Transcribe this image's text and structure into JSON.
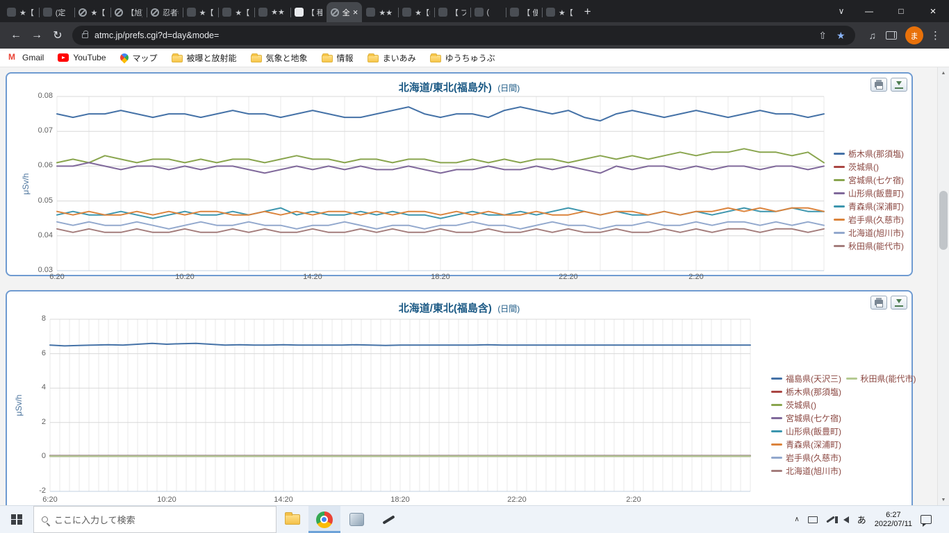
{
  "browser": {
    "tabs": [
      {
        "label": "★【",
        "favicon": "dark"
      },
      {
        "label": "(定",
        "favicon": "dark"
      },
      {
        "label": "★【",
        "favicon": "circle"
      },
      {
        "label": "【旭]",
        "favicon": "circle"
      },
      {
        "label": "忍者=",
        "favicon": "circle"
      },
      {
        "label": "★【",
        "favicon": "dark"
      },
      {
        "label": "★【",
        "favicon": "dark"
      },
      {
        "label": "★★",
        "favicon": "dark"
      },
      {
        "label": "【 種",
        "favicon": "light"
      },
      {
        "label": "全",
        "favicon": "circle",
        "active": true
      },
      {
        "label": "★★【",
        "favicon": "dark"
      },
      {
        "label": "★【≡",
        "favicon": "dark"
      },
      {
        "label": "【 フ",
        "favicon": "dark"
      },
      {
        "label": "(",
        "favicon": "dark"
      },
      {
        "label": "【 便",
        "favicon": "dark"
      },
      {
        "label": "★【",
        "favicon": "dark"
      }
    ],
    "tab_close_glyph": "×",
    "new_tab_glyph": "+",
    "tab_search_glyph": "∨",
    "window_controls": {
      "minimize": "—",
      "maximize": "□",
      "close": "×"
    },
    "nav": {
      "back": "←",
      "forward": "→",
      "reload": "↻",
      "url": "atmc.jp/prefs.cgi?d=day&mode=",
      "share": "⇧",
      "star": "★",
      "media": "♫",
      "menu": "⋮",
      "profile_initial": "ま"
    },
    "bookmarks": [
      {
        "label": "Gmail",
        "icon": "gmail"
      },
      {
        "label": "YouTube",
        "icon": "youtube"
      },
      {
        "label": "マップ",
        "icon": "maps"
      },
      {
        "label": "被曝と放射能",
        "icon": "folder"
      },
      {
        "label": "気象と地象",
        "icon": "folder"
      },
      {
        "label": "情報",
        "icon": "folder"
      },
      {
        "label": "まいあみ",
        "icon": "folder"
      },
      {
        "label": "ゆうちゅうぶ",
        "icon": "folder"
      }
    ]
  },
  "chart_data": [
    {
      "type": "line",
      "title": "北海道/東北(福島外)",
      "subtitle": "(日間)",
      "ylabel": "μSv/h",
      "ylim": [
        0.03,
        0.08
      ],
      "yticks": [
        "0.08",
        "0.07",
        "0.06",
        "0.05",
        "0.04",
        "0.03"
      ],
      "xticklabels": [
        "6:20",
        "10:20",
        "14:20",
        "18:20",
        "22:20",
        "2:20"
      ],
      "x_span_hours": 24,
      "xtick_every_hours": 4,
      "vgrid_per_hour": 1,
      "grid": true,
      "legend_position": "right",
      "series": [
        {
          "name": "栃木県(那須塩)",
          "color": "#4572a7",
          "values": [
            0.075,
            0.074,
            0.075,
            0.075,
            0.076,
            0.075,
            0.074,
            0.075,
            0.075,
            0.074,
            0.075,
            0.076,
            0.075,
            0.075,
            0.074,
            0.075,
            0.076,
            0.075,
            0.074,
            0.074,
            0.075,
            0.076,
            0.077,
            0.075,
            0.074,
            0.075,
            0.075,
            0.074,
            0.076,
            0.077,
            0.076,
            0.075,
            0.076,
            0.074,
            0.073,
            0.075,
            0.076,
            0.075,
            0.074,
            0.075,
            0.076,
            0.075,
            0.074,
            0.075,
            0.076,
            0.075,
            0.075,
            0.074,
            0.075
          ]
        },
        {
          "name": "茨城県()",
          "color": "#aa4643",
          "values": []
        },
        {
          "name": "宮城県(七ケ宿)",
          "color": "#89a54e",
          "values": [
            0.061,
            0.062,
            0.061,
            0.063,
            0.062,
            0.061,
            0.062,
            0.062,
            0.061,
            0.062,
            0.061,
            0.062,
            0.062,
            0.061,
            0.062,
            0.063,
            0.062,
            0.062,
            0.061,
            0.062,
            0.062,
            0.061,
            0.062,
            0.062,
            0.061,
            0.061,
            0.062,
            0.061,
            0.062,
            0.061,
            0.062,
            0.062,
            0.061,
            0.062,
            0.063,
            0.062,
            0.063,
            0.062,
            0.063,
            0.064,
            0.063,
            0.064,
            0.064,
            0.065,
            0.064,
            0.064,
            0.063,
            0.064,
            0.061
          ]
        },
        {
          "name": "山形県(飯豊町)",
          "color": "#80699b",
          "values": [
            0.06,
            0.06,
            0.061,
            0.06,
            0.059,
            0.06,
            0.06,
            0.059,
            0.06,
            0.059,
            0.06,
            0.06,
            0.059,
            0.058,
            0.059,
            0.06,
            0.059,
            0.06,
            0.059,
            0.06,
            0.059,
            0.059,
            0.06,
            0.059,
            0.058,
            0.059,
            0.059,
            0.06,
            0.059,
            0.059,
            0.06,
            0.059,
            0.06,
            0.059,
            0.058,
            0.06,
            0.059,
            0.06,
            0.06,
            0.059,
            0.06,
            0.059,
            0.06,
            0.06,
            0.059,
            0.06,
            0.06,
            0.059,
            0.06
          ]
        },
        {
          "name": "青森県(深浦町)",
          "color": "#3d96ae",
          "values": [
            0.046,
            0.047,
            0.046,
            0.046,
            0.047,
            0.046,
            0.045,
            0.046,
            0.047,
            0.046,
            0.046,
            0.047,
            0.046,
            0.047,
            0.048,
            0.046,
            0.047,
            0.046,
            0.046,
            0.047,
            0.046,
            0.047,
            0.046,
            0.046,
            0.045,
            0.046,
            0.047,
            0.046,
            0.046,
            0.047,
            0.046,
            0.047,
            0.048,
            0.047,
            0.046,
            0.047,
            0.046,
            0.046,
            0.047,
            0.046,
            0.047,
            0.046,
            0.047,
            0.048,
            0.047,
            0.047,
            0.048,
            0.047,
            0.047
          ]
        },
        {
          "name": "岩手県(久慈市)",
          "color": "#db843d",
          "values": [
            0.047,
            0.046,
            0.047,
            0.046,
            0.046,
            0.047,
            0.046,
            0.047,
            0.046,
            0.047,
            0.047,
            0.046,
            0.046,
            0.047,
            0.046,
            0.047,
            0.046,
            0.047,
            0.047,
            0.046,
            0.047,
            0.046,
            0.047,
            0.047,
            0.046,
            0.047,
            0.046,
            0.047,
            0.046,
            0.046,
            0.047,
            0.046,
            0.046,
            0.047,
            0.046,
            0.047,
            0.047,
            0.046,
            0.047,
            0.046,
            0.047,
            0.047,
            0.048,
            0.047,
            0.048,
            0.047,
            0.048,
            0.048,
            0.047
          ]
        },
        {
          "name": "北海道(旭川市)",
          "color": "#92a8cd",
          "values": [
            0.044,
            0.043,
            0.044,
            0.043,
            0.043,
            0.044,
            0.043,
            0.042,
            0.043,
            0.044,
            0.043,
            0.043,
            0.044,
            0.043,
            0.043,
            0.042,
            0.043,
            0.043,
            0.044,
            0.043,
            0.042,
            0.043,
            0.043,
            0.042,
            0.043,
            0.043,
            0.044,
            0.043,
            0.043,
            0.042,
            0.043,
            0.044,
            0.043,
            0.043,
            0.042,
            0.043,
            0.043,
            0.044,
            0.043,
            0.043,
            0.044,
            0.043,
            0.044,
            0.044,
            0.043,
            0.044,
            0.043,
            0.044,
            0.043
          ]
        },
        {
          "name": "秋田県(能代市)",
          "color": "#a47d7c",
          "values": [
            0.042,
            0.041,
            0.042,
            0.041,
            0.041,
            0.042,
            0.041,
            0.041,
            0.042,
            0.041,
            0.041,
            0.042,
            0.041,
            0.042,
            0.041,
            0.041,
            0.042,
            0.041,
            0.041,
            0.042,
            0.041,
            0.042,
            0.041,
            0.041,
            0.042,
            0.041,
            0.041,
            0.042,
            0.041,
            0.041,
            0.042,
            0.041,
            0.042,
            0.041,
            0.041,
            0.042,
            0.041,
            0.041,
            0.042,
            0.041,
            0.042,
            0.041,
            0.042,
            0.042,
            0.041,
            0.042,
            0.042,
            0.041,
            0.042
          ]
        }
      ]
    },
    {
      "type": "line",
      "title": "北海道/東北(福島含)",
      "subtitle": "(日間)",
      "ylabel": "μSv/h",
      "ylim": [
        -2,
        8
      ],
      "yticks": [
        "8",
        "6",
        "4",
        "2",
        "0",
        "-2"
      ],
      "xticklabels": [
        "6:20",
        "10:20",
        "14:20",
        "18:20",
        "22:20",
        "2:20"
      ],
      "x_span_hours": 24,
      "xtick_every_hours": 4,
      "vgrid_per_hour": 3,
      "grid": true,
      "legend_position": "right",
      "series": [
        {
          "name": "福島県(天沢三)",
          "color": "#4572a7",
          "values": [
            6.5,
            6.45,
            6.48,
            6.5,
            6.52,
            6.5,
            6.55,
            6.6,
            6.55,
            6.58,
            6.6,
            6.55,
            6.5,
            6.52,
            6.5,
            6.5,
            6.52,
            6.5,
            6.5,
            6.5,
            6.5,
            6.52,
            6.5,
            6.48,
            6.5,
            6.5,
            6.5,
            6.5,
            6.5,
            6.5,
            6.52,
            6.5,
            6.5,
            6.5,
            6.5,
            6.5,
            6.5,
            6.5,
            6.5,
            6.5,
            6.5,
            6.5,
            6.5,
            6.5,
            6.5,
            6.5,
            6.5,
            6.5,
            6.5
          ]
        },
        {
          "name": "栃木県(那須塩)",
          "color": "#aa4643",
          "values": [
            0.075
          ]
        },
        {
          "name": "茨城県()",
          "color": "#89a54e",
          "values": []
        },
        {
          "name": "宮城県(七ケ宿)",
          "color": "#80699b",
          "values": [
            0.062
          ]
        },
        {
          "name": "山形県(飯豊町)",
          "color": "#3d96ae",
          "values": [
            0.06
          ]
        },
        {
          "name": "青森県(深浦町)",
          "color": "#db843d",
          "values": [
            0.047
          ]
        },
        {
          "name": "岩手県(久慈市)",
          "color": "#92a8cd",
          "values": [
            0.047
          ]
        },
        {
          "name": "北海道(旭川市)",
          "color": "#a47d7c",
          "values": [
            0.043
          ]
        },
        {
          "name": "秋田県(能代市)",
          "color": "#b5ca92",
          "values": [
            0.042
          ]
        }
      ]
    }
  ],
  "taskbar": {
    "search_placeholder": "ここに入力して検索",
    "ime": "あ",
    "time": "6:27",
    "date": "2022/07/11",
    "tray_chevron": "∧"
  },
  "colors": {
    "accent_border": "#6f9bd1",
    "title": "#1c5a85",
    "legend_text": "#8b4741",
    "axis_text": "#606060",
    "axis_title": "#4d759e",
    "grid_h": "#d8d8d8",
    "grid_v": "#e9e9e9",
    "axis_line": "#c0d0e0",
    "palette": [
      "#4572a7",
      "#aa4643",
      "#89a54e",
      "#80699b",
      "#3d96ae",
      "#db843d",
      "#92a8cd",
      "#a47d7c",
      "#b5ca92"
    ]
  }
}
